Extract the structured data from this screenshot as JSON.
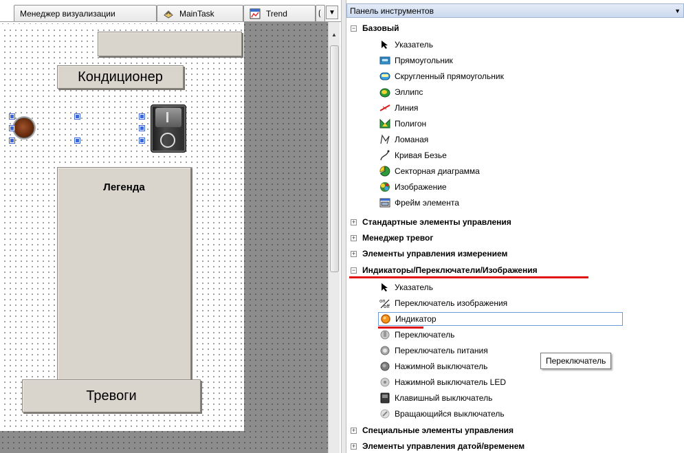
{
  "tabs": [
    {
      "label": "Менеджер визуализации",
      "icon": "none"
    },
    {
      "label": "MainTask",
      "icon": "task-icon"
    },
    {
      "label": "Trend",
      "icon": "trend-icon"
    }
  ],
  "canvas": {
    "conditioner_label": "Кондиционер",
    "legend_label": "Легенда",
    "alarms_label": "Тревоги"
  },
  "toolbox": {
    "title": "Панель инструментов",
    "categories": {
      "basic": {
        "label": "Базовый",
        "expanded": true
      },
      "standard": {
        "label": "Стандартные элементы управления",
        "expanded": false
      },
      "alarm": {
        "label": "Менеджер тревог",
        "expanded": false
      },
      "measure": {
        "label": "Элементы управления измерением",
        "expanded": false
      },
      "indicators": {
        "label": "Индикаторы/Переключатели/Изображения",
        "expanded": true
      },
      "special": {
        "label": "Специальные элементы управления",
        "expanded": false
      },
      "datetime": {
        "label": "Элементы управления датой/временем",
        "expanded": false
      }
    },
    "basic_items": [
      {
        "label": "Указатель",
        "icon": "pointer-icon"
      },
      {
        "label": "Прямоугольник",
        "icon": "rectangle-icon"
      },
      {
        "label": "Скругленный прямоугольник",
        "icon": "rounded-rectangle-icon"
      },
      {
        "label": "Эллипс",
        "icon": "ellipse-icon"
      },
      {
        "label": "Линия",
        "icon": "line-icon"
      },
      {
        "label": "Полигон",
        "icon": "polygon-icon"
      },
      {
        "label": "Ломаная",
        "icon": "polyline-icon"
      },
      {
        "label": "Кривая Безье",
        "icon": "bezier-icon"
      },
      {
        "label": "Секторная диаграмма",
        "icon": "pie-chart-icon"
      },
      {
        "label": "Изображение",
        "icon": "image-icon"
      },
      {
        "label": "Фрейм элемента",
        "icon": "frame-icon"
      }
    ],
    "indicator_items": [
      {
        "label": "Указатель",
        "icon": "pointer-icon"
      },
      {
        "label": "Переключатель изображения",
        "icon": "on-off-icon"
      },
      {
        "label": "Индикатор",
        "icon": "lamp-icon"
      },
      {
        "label": "Переключатель",
        "icon": "switch-icon"
      },
      {
        "label": "Переключатель питания",
        "icon": "power-switch-icon"
      },
      {
        "label": "Нажимной выключатель",
        "icon": "push-switch-icon"
      },
      {
        "label": "Нажимной выключатель LED",
        "icon": "push-switch-led-icon"
      },
      {
        "label": "Клавишный выключатель",
        "icon": "rocker-switch-icon"
      },
      {
        "label": "Вращающийся выключатель",
        "icon": "rotary-switch-icon"
      }
    ],
    "selected_item": "Индикатор",
    "tooltip": "Переключатель"
  },
  "colors": {
    "accent_red": "#e21111",
    "selection_blue": "#3b64d9"
  }
}
